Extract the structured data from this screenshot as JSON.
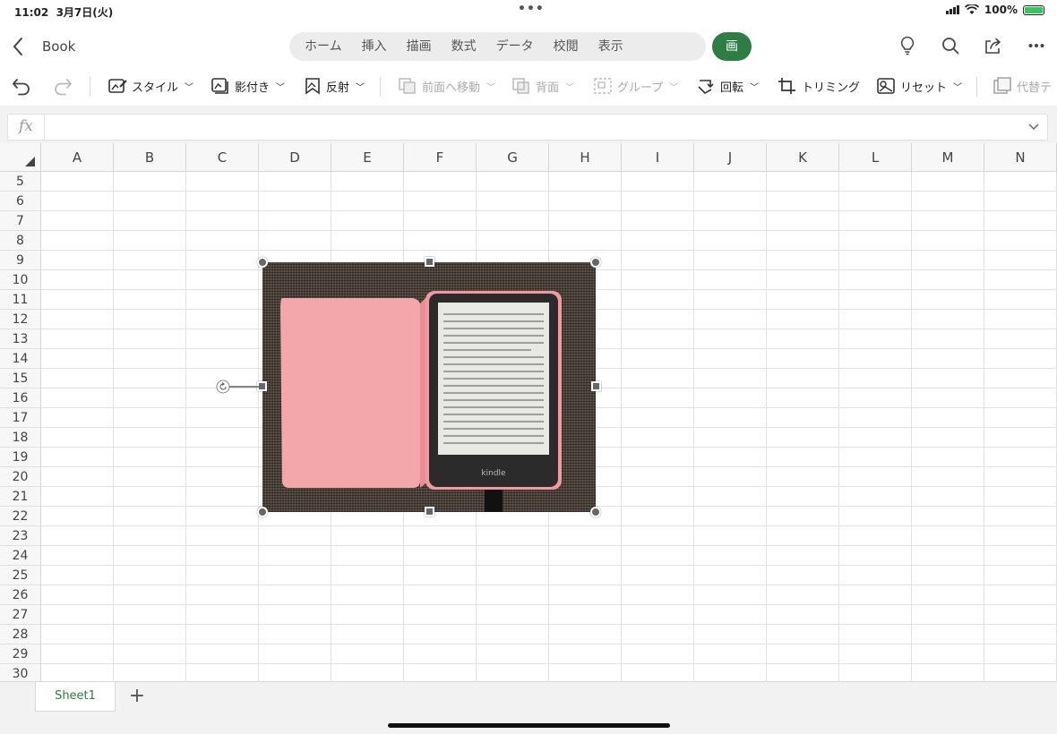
{
  "status": {
    "time": "11:02",
    "date": "3月7日(火)",
    "battery": "100%"
  },
  "header": {
    "title": "Book",
    "tabs": [
      "ホーム",
      "挿入",
      "描画",
      "数式",
      "データ",
      "校閲",
      "表示",
      "画像"
    ],
    "active_tab": "画像"
  },
  "toolbar": {
    "style": "スタイル",
    "shadow": "影付き",
    "reflection": "反射",
    "bring_forward": "前面へ移動",
    "send_back": "背面",
    "group": "グループ",
    "rotate": "回転",
    "crop": "トリミング",
    "reset": "リセット",
    "alt": "代替テ"
  },
  "formula": {
    "label": "fx",
    "value": ""
  },
  "grid": {
    "columns": [
      "A",
      "B",
      "C",
      "D",
      "E",
      "F",
      "G",
      "H",
      "I",
      "J",
      "K",
      "L",
      "M",
      "N"
    ],
    "rows": [
      "5",
      "6",
      "7",
      "8",
      "9",
      "10",
      "11",
      "12",
      "13",
      "14",
      "15",
      "16",
      "17",
      "18",
      "19",
      "20",
      "21",
      "22",
      "23",
      "24",
      "25",
      "26",
      "27",
      "28",
      "29",
      "30"
    ]
  },
  "picture": {
    "device_text": "kindle",
    "case_color": "#f4a7aa",
    "background_color": "#4a4037"
  },
  "sheets": {
    "tabs": [
      "Sheet1"
    ],
    "add": "+"
  },
  "colors": {
    "accent": "#2e7d44"
  }
}
